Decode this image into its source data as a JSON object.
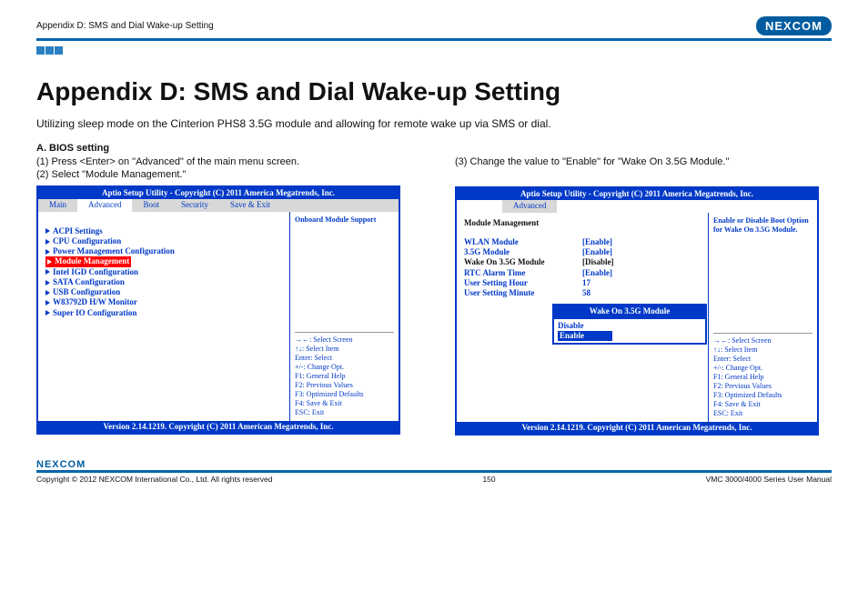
{
  "header": {
    "breadcrumb": "Appendix D: SMS and Dial Wake-up Setting",
    "logo_text": "NEXCOM"
  },
  "title": "Appendix D: SMS and Dial Wake-up Setting",
  "intro": "Utilizing sleep mode on the Cinterion PHS8 3.5G module and allowing for remote wake up via SMS or dial.",
  "section_a": {
    "heading": "A. BIOS setting",
    "step1": "(1) Press <Enter> on \"Advanced\" of the main menu screen.",
    "step2": "(2) Select \"Module Management.\"",
    "step3": "(3) Change the value to \"Enable\" for \"Wake On 3.5G Module.\""
  },
  "bios_common": {
    "title": "Aptio Setup Utility - Copyright (C) 2011 America Megatrends, Inc.",
    "footer": "Version 2.14.1219. Copyright (C) 2011 American Megatrends, Inc.",
    "help_lines": {
      "l1": "→←: Select Screen",
      "l2": "↑↓: Select Item",
      "l3": "Enter: Select",
      "l4": "+/-: Change Opt.",
      "l5": "F1: General Help",
      "l6": "F2: Previous Values",
      "l7": "F3: Optimized Defaults",
      "l8": "F4: Save & Exit",
      "l9": "ESC: Exit"
    }
  },
  "bios_left": {
    "tabs": {
      "t1": "Main",
      "t2": "Advanced",
      "t3": "Boot",
      "t4": "Security",
      "t5": "Save & Exit"
    },
    "side_title": "Onboard Module Support",
    "items": {
      "i1": "ACPI Settings",
      "i2": "CPU Configuration",
      "i3": "Power Management Configuration",
      "i4": "Module Management",
      "i5": "Intel IGD Configuration",
      "i6": "SATA Configuration",
      "i7": "USB Configuration",
      "i8": "W83792D H/W Monitor",
      "i9": "Super IO Configuration"
    }
  },
  "bios_right": {
    "tab": "Advanced",
    "section_title": "Module Management",
    "side_title": "Enable or Disable Boot Option for Wake On 3.5G Module.",
    "rows": {
      "r1k": "WLAN Module",
      "r1v": "[Enable]",
      "r2k": "3.5G Module",
      "r2v": "[Enable]",
      "r3k": "Wake On 3.5G Module",
      "r3v": "[Disable]",
      "r4k": "RTC Alarm Time",
      "r4v": "[Enable]",
      "r5k": "User Setting Hour",
      "r5v": "17",
      "r6k": "User Setting Minute",
      "r6v": "58"
    },
    "popup": {
      "title": "Wake On 3.5G Module",
      "opt1": "Disable",
      "opt2": "Enable"
    }
  },
  "footer": {
    "logo": "NEXCOM",
    "copyright": "Copyright © 2012 NEXCOM International Co., Ltd. All rights reserved",
    "page_num": "150",
    "doc": "VMC 3000/4000 Series User Manual"
  }
}
